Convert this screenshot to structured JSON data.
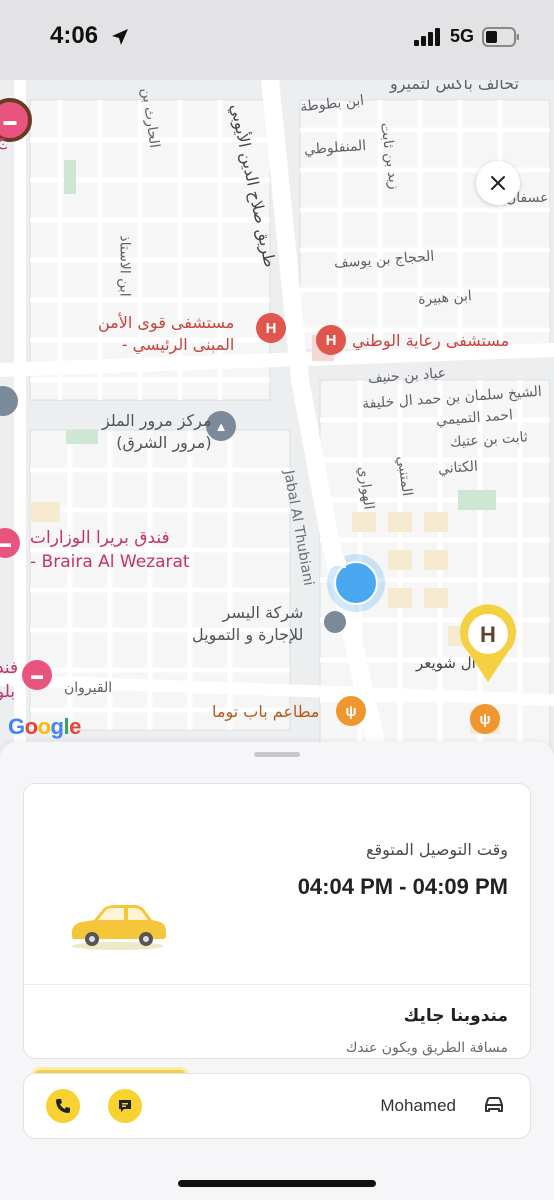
{
  "status_bar": {
    "time": "4:06",
    "network": "5G"
  },
  "map": {
    "labels": {
      "top_street": "تحالف باكس لتميرو",
      "ibn_battuta": "ابن بطوطة",
      "al_harith": "الحارث بن",
      "al_manfaluti": "المنفلوطي",
      "zaid_thabit": "زيد بن ثابت",
      "asfan": "عسفان",
      "salahuddin_road": "طريق صلاح الدين الأيوبي",
      "ibn_al_ustadh": "ابن الاستاذ",
      "hajjaj": "الحجاج بن يوسف",
      "ibn_hubaira": "ابن هبيرة",
      "ayad": "عياد بن حنيف",
      "sheikh_salman": "الشيخ سلمان بن حمد ال خليفة",
      "ahmed_tamimi": "احمد التميمي",
      "thabit_ateek": "ثابت بن عتيك",
      "al_kittani": "الكتاني",
      "al_mutanabbi": "المتنبي",
      "al_hawari": "الهواري",
      "jabal_thubiani": "Jabal Al Thubiani",
      "al_qairawan": "القيروان",
      "al_shuwair": "ال شويعر"
    },
    "pois": {
      "security_hospital": "مستشفى قوى الأمن\n- المبنى الرئيسي",
      "national_care": "مستشفى رعاية الوطني",
      "traffic_center": "مركز مرور الملز\n(مرور الشرق)",
      "braira_hotel": "فندق بريرا الوزارات\n- Braira Al Wezarat",
      "al_yusr": "شركة اليسر\nللإجارة و التمويل",
      "bab_touma": "مطاعم باب توما",
      "left_hotel_edge": "فند\nبلو",
      "top_left_edge": "ج"
    },
    "attribution": "Google"
  },
  "delivery": {
    "eta_label": "وقت التوصيل المتوقع",
    "eta_time": "04:04 PM - 04:09 PM",
    "status_title": "مندوبنا جايك",
    "status_subtitle": "مسافة الطريق ويكون عندك",
    "progress_active_step": 1,
    "progress_total_steps": 3
  },
  "driver": {
    "name": "Mohamed"
  },
  "colors": {
    "accent_yellow": "#f5d040",
    "location_blue": "#4aa8f0",
    "hotel_pink": "#e9547f"
  },
  "icons": {
    "close": "close-icon",
    "phone": "phone-icon",
    "chat": "chat-icon",
    "car": "car-icon",
    "location_arrow": "location-arrow-icon"
  }
}
